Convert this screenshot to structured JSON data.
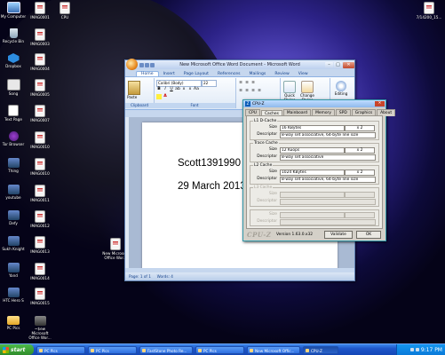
{
  "desktop": {
    "icons": [
      {
        "label": "My Computer",
        "icon": "computer-icon"
      },
      {
        "label": "IMAG0001",
        "icon": "image-file-icon"
      },
      {
        "label": "CPU",
        "icon": "document-icon"
      },
      {
        "label": "7/14200_15...",
        "icon": "document-icon"
      },
      {
        "label": "Recycle Bin",
        "icon": "recycle-bin-icon"
      },
      {
        "label": "IMAG0003",
        "icon": "image-file-icon"
      },
      {
        "label": "Dropbox",
        "icon": "dropbox-icon"
      },
      {
        "label": "IMAG0004",
        "icon": "image-file-icon"
      },
      {
        "label": "Song",
        "icon": "music-file-icon"
      },
      {
        "label": "IMAG0005",
        "icon": "image-file-icon"
      },
      {
        "label": "Text Page",
        "icon": "text-file-icon"
      },
      {
        "label": "IMAG0007",
        "icon": "image-file-icon"
      },
      {
        "label": "Tor Browser",
        "icon": "tor-browser-icon"
      },
      {
        "label": "IMAG0010",
        "icon": "image-file-icon"
      },
      {
        "label": "Thing",
        "icon": "app-icon"
      },
      {
        "label": "IMAG0010",
        "icon": "image-file-icon"
      },
      {
        "label": "youtube",
        "icon": "app-icon"
      },
      {
        "label": "IMAG0011",
        "icon": "image-file-icon"
      },
      {
        "label": "Defy",
        "icon": "app-icon"
      },
      {
        "label": "IMAG0012",
        "icon": "image-file-icon"
      },
      {
        "label": "Sukh Knight",
        "icon": "app-icon"
      },
      {
        "label": "IMAG0013",
        "icon": "image-file-icon"
      },
      {
        "label": "Yand",
        "icon": "app-icon"
      },
      {
        "label": "IMAG0014",
        "icon": "image-file-icon"
      },
      {
        "label": "HTC Hero S",
        "icon": "app-icon"
      },
      {
        "label": "IMAG0015",
        "icon": "image-file-icon"
      },
      {
        "label": "PC Pics",
        "icon": "folder-icon"
      },
      {
        "label": "~$ew Microsoft Office Wor...",
        "icon": "batch-file-icon"
      },
      {
        "label": "New Microsoft Office Wor...",
        "icon": "document-icon"
      }
    ]
  },
  "word": {
    "title": "New Microsoft Office Word Document - Microsoft Word",
    "tabs": [
      "Home",
      "Insert",
      "Page Layout",
      "References",
      "Mailings",
      "Review",
      "View"
    ],
    "active_tab": "Home",
    "font_name": "Calibri (Body)",
    "font_size": "22",
    "groups": {
      "clipboard": "Clipboard",
      "font": "Font",
      "styles": "Styles",
      "editing": "Editing"
    },
    "paste_label": "Paste",
    "quick_styles_label": "Quick Styles",
    "change_styles_label": "Change Styles",
    "editing_label": "Editing",
    "doc_lines": [
      "Scott1391990",
      "29 March 2013"
    ],
    "status_page": "Page: 1 of 1",
    "status_words": "Words: 4"
  },
  "cpuz": {
    "title": "CPU-Z",
    "tabs": [
      "CPU",
      "Caches",
      "Mainboard",
      "Memory",
      "SPD",
      "Graphics",
      "About"
    ],
    "active_tab": "Caches",
    "l1_legend": "L1 D-Cache",
    "l1_size": "16 KBytes",
    "l1_mult": "x 2",
    "l1_descriptor": "8-way set associative, 64-byte line size",
    "trace_legend": "Trace Cache",
    "trace_size": "12 Kuops",
    "trace_mult": "x 2",
    "trace_descriptor": "8-way set associative",
    "l2_legend": "L2 Cache",
    "l2_size": "1024 KBytes",
    "l2_mult": "x 2",
    "l2_descriptor": "8-way set associative, 64-byte line size",
    "l3_legend": "L3 Cache",
    "size_label": "Size",
    "descriptor_label": "Descriptor",
    "brand": "CPU-Z",
    "version": "Version 1.63.0.x32",
    "validate_label": "Validate",
    "ok_label": "OK"
  },
  "taskbar": {
    "start_label": "start",
    "tasks": [
      "PC Pics",
      "PC Pics",
      "FastStone Photo Re...",
      "PC Pics",
      "New Microsoft Offic...",
      "CPU-Z"
    ],
    "active_task_index": 5,
    "clock": "9:17 PM"
  }
}
